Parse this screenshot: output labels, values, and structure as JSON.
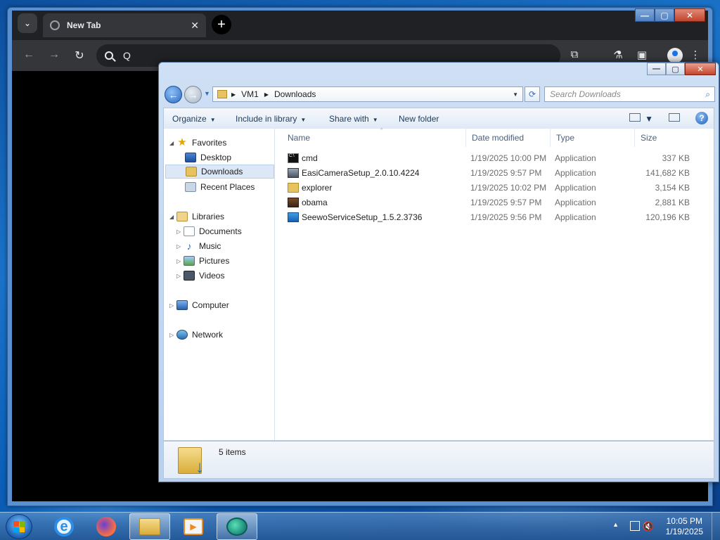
{
  "chrome": {
    "tab_title": "New Tab",
    "tab_close": "✕",
    "new_tab": "+",
    "omnibox_text": "Q",
    "window_controls": [
      "—",
      "▢",
      "✕"
    ]
  },
  "explorer": {
    "window_controls": [
      "—",
      "▢",
      "✕"
    ],
    "breadcrumb": [
      "VM1",
      "Downloads"
    ],
    "search_placeholder": "Search Downloads",
    "commands": [
      {
        "label": "Organize",
        "has_caret": true
      },
      {
        "label": "Include in library",
        "has_caret": true
      },
      {
        "label": "Share with",
        "has_caret": true
      },
      {
        "label": "New folder",
        "has_caret": false
      }
    ],
    "nav": {
      "favorites": "Favorites",
      "desktop": "Desktop",
      "downloads": "Downloads",
      "recent_places": "Recent Places",
      "libraries": "Libraries",
      "documents": "Documents",
      "music": "Music",
      "pictures": "Pictures",
      "videos": "Videos",
      "computer": "Computer",
      "network": "Network"
    },
    "columns": {
      "name": "Name",
      "date_modified": "Date modified",
      "type": "Type",
      "size": "Size"
    },
    "files": [
      {
        "name": "cmd",
        "date": "1/19/2025 10:00 PM",
        "type": "Application",
        "size": "337 KB",
        "icon": "cmd-icon"
      },
      {
        "name": "EasiCameraSetup_2.0.10.4224",
        "date": "1/19/2025 9:57 PM",
        "type": "Application",
        "size": "141,682 KB",
        "icon": "camera-setup-icon"
      },
      {
        "name": "explorer",
        "date": "1/19/2025 10:02 PM",
        "type": "Application",
        "size": "3,154 KB",
        "icon": "explorer-folder-icon"
      },
      {
        "name": "obama",
        "date": "1/19/2025 9:57 PM",
        "type": "Application",
        "size": "2,881 KB",
        "icon": "photo-app-icon"
      },
      {
        "name": "SeewoServiceSetup_1.5.2.3736",
        "date": "1/19/2025 9:56 PM",
        "type": "Application",
        "size": "120,196 KB",
        "icon": "seewo-setup-icon"
      }
    ],
    "status": "5 items"
  },
  "taskbar": {
    "time": "10:05 PM",
    "date": "1/19/2025",
    "apps": [
      "internet-explorer-icon",
      "firefox-icon",
      "file-explorer-icon",
      "media-player-icon",
      "easicamera-icon"
    ]
  }
}
